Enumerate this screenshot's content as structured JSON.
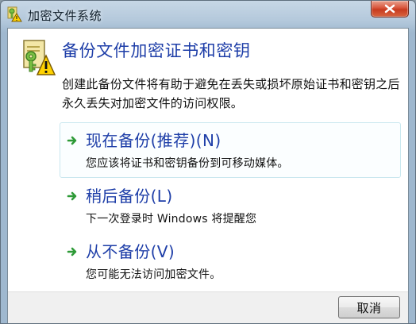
{
  "window": {
    "title": "加密文件系统"
  },
  "header": {
    "heading": "备份文件加密证书和密钥",
    "description": "创建此备份文件将有助于避免在丢失或损坏原始证书和密钥之后永久丢失对加密文件的访问权限。"
  },
  "options": [
    {
      "title": "现在备份(推荐)(N)",
      "description": "您应该将证书和密钥备份到可移动媒体。"
    },
    {
      "title": "稍后备份(L)",
      "description": "下一次登录时 Windows 将提醒您"
    },
    {
      "title": "从不备份(V)",
      "description": "您可能无法访问加密文件。"
    }
  ],
  "buttons": {
    "cancel": "取消"
  },
  "icons": {
    "title": "efs-key-warning-icon",
    "header": "certificate-key-warning-icon",
    "close": "close-icon",
    "option_arrow": "green-arrow-icon"
  },
  "colors": {
    "heading": "#1e3ea8",
    "link": "#1e3ea8",
    "close_button": "#d8553b",
    "arrow": "#2e9a37"
  }
}
